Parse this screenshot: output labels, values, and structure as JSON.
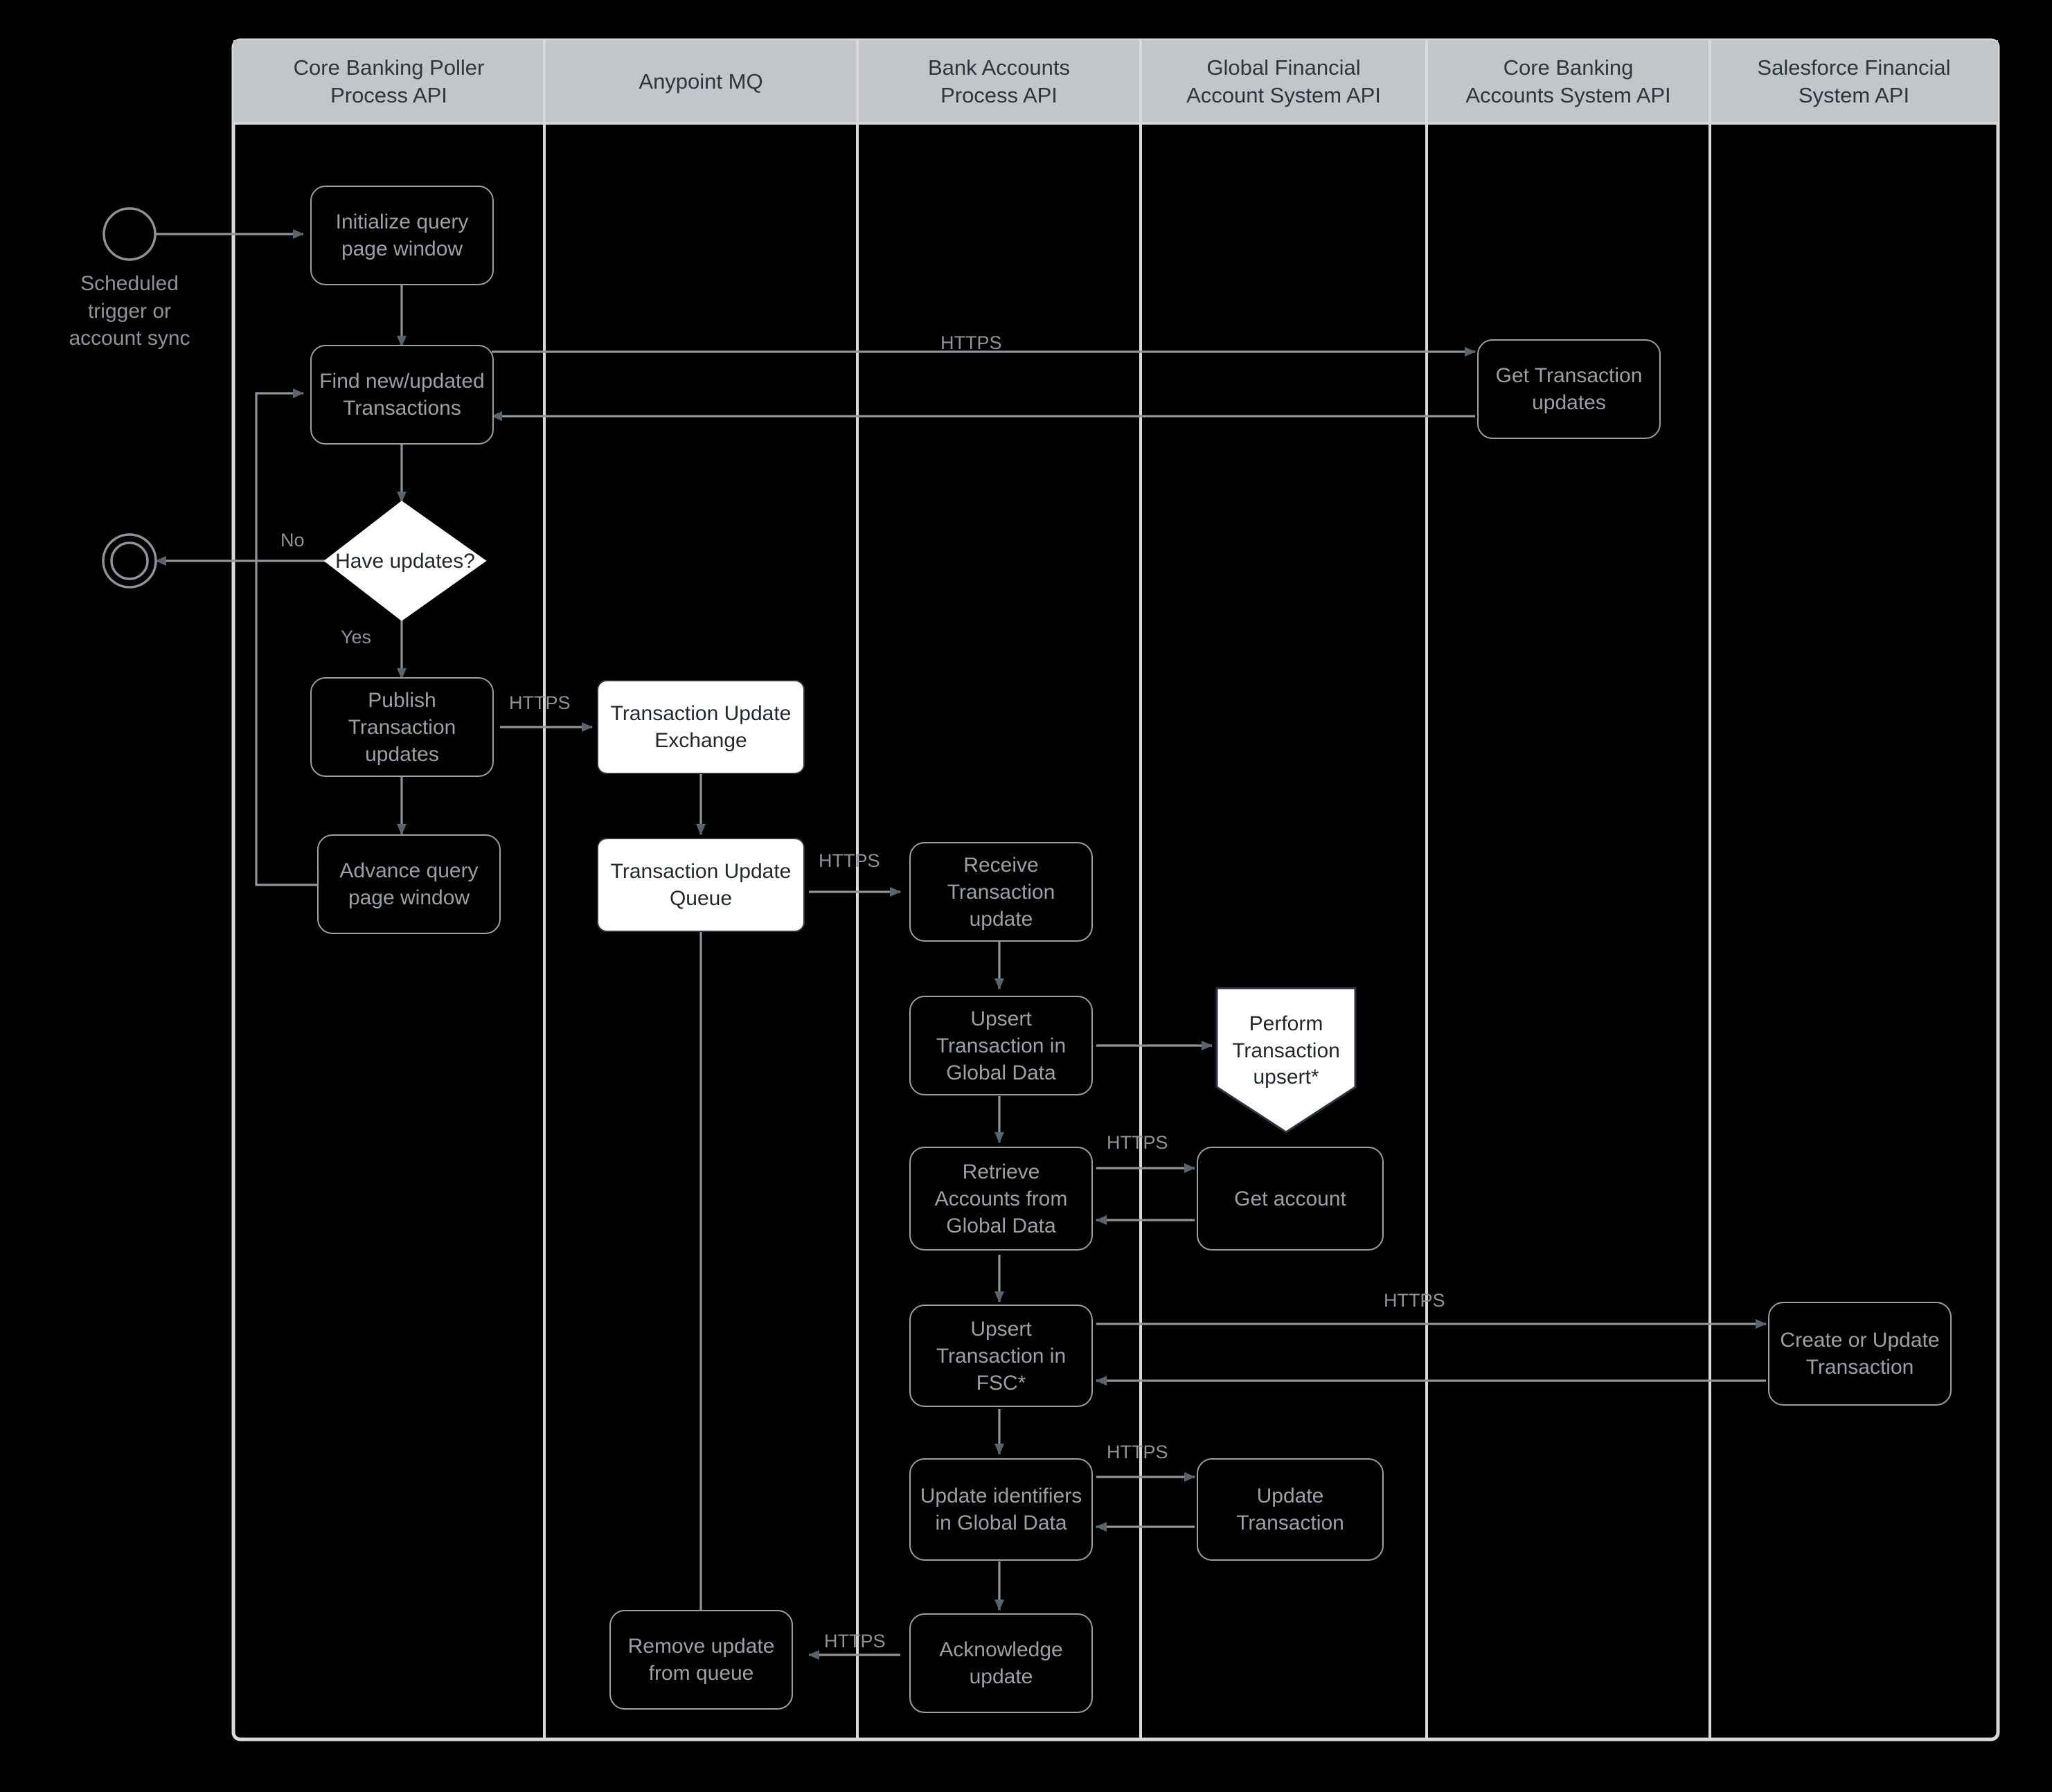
{
  "diagram": {
    "title": "Transaction synchronization swimlane flow",
    "colors": {
      "background": "#000000",
      "lane_header_fill": "#c3c6c9",
      "lane_header_text": "#2b3640",
      "lane_border": "#d9d9d9",
      "node_dark_border": "#9aa1a6",
      "node_dark_text": "#9aa1a6",
      "node_white_fill": "#ffffff",
      "node_white_text": "#21282f",
      "connector": "#8d949a",
      "arrowhead": "#5a646e"
    },
    "lanes": [
      {
        "id": "poller",
        "label": "Core Banking Poller\nProcess API"
      },
      {
        "id": "mq",
        "label": "Anypoint MQ"
      },
      {
        "id": "bank",
        "label": "Bank Accounts\nProcess API"
      },
      {
        "id": "gfa",
        "label": "Global Financial\nAccount System API"
      },
      {
        "id": "cba",
        "label": "Core Banking\nAccounts System API"
      },
      {
        "id": "sfsa",
        "label": "Salesforce Financial\nSystem API"
      }
    ],
    "lane_titles": {
      "poller_line1": "Core Banking Poller",
      "poller_line2": "Process API",
      "mq_line1": "Anypoint MQ",
      "bank_line1": "Bank Accounts",
      "bank_line2": "Process API",
      "gfa_line1": "Global Financial",
      "gfa_line2": "Account System API",
      "cba_line1": "Core Banking",
      "cba_line2": "Accounts System API",
      "sfsa_line1": "Salesforce Financial",
      "sfsa_line2": "System API"
    },
    "start": {
      "caption": "Scheduled\ntrigger or\naccount sync"
    },
    "nodes": {
      "initialize_query": "Initialize query page window",
      "find_transactions": "Find new/updated Transactions",
      "have_updates": "Have updates?",
      "publish_updates": "Publish Transaction updates",
      "advance_window": "Advance query page window",
      "tx_update_exchange": "Transaction Update Exchange",
      "tx_update_queue": "Transaction Update Queue",
      "remove_from_queue": "Remove update from queue",
      "receive_update": "Receive Transaction update",
      "upsert_global": "Upsert Transaction in Global Data",
      "retrieve_accounts": "Retrieve Accounts from Global Data",
      "upsert_fsc": "Upsert Transaction in FSC*",
      "update_identifiers": "Update identifiers in Global Data",
      "acknowledge_update": "Acknowledge update",
      "perform_upsert": "Perform Transaction upsert*",
      "get_account": "Get account",
      "get_tx_updates": "Get Transaction updates",
      "create_or_update_tx": "Create or Update Transaction",
      "update_transaction": "Update Transaction"
    },
    "edge_labels": {
      "https_top": "HTTPS",
      "no": "No",
      "yes": "Yes",
      "https_publish": "HTTPS",
      "https_queue_to_bank": "HTTPS",
      "https_retrieve": "HTTPS",
      "https_fsc": "HTTPS",
      "https_update_ids": "HTTPS",
      "https_ack": "HTTPS"
    }
  }
}
